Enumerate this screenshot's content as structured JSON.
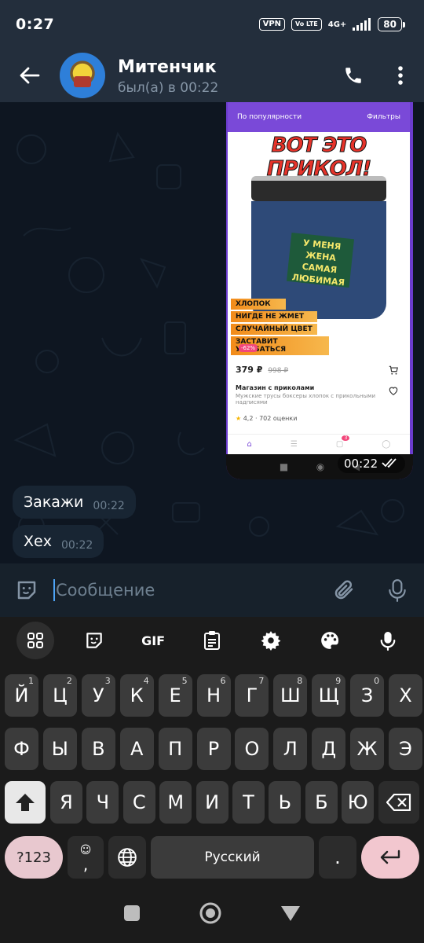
{
  "status_bar": {
    "time": "0:27",
    "vpn": "VPN",
    "volte": "Vo LTE",
    "network": "4G+",
    "battery": "80"
  },
  "header": {
    "name": "Митенчик",
    "status": "был(а) в 00:22"
  },
  "photo": {
    "filter_sort": "По популярности",
    "filter_label": "Фильтры",
    "headline": "ВОТ ЭТО ПРИКОЛ!",
    "print_text": [
      "У МЕНЯ ЖЕНА",
      "САМАЯ",
      "ЛЮБИМАЯ"
    ],
    "tags": [
      "ХЛОПОК",
      "НИГДЕ НЕ ЖМЕТ",
      "СЛУЧАЙНЫЙ ЦВЕТ",
      "ЗАСТАВИТ УЛЫБАТЬСЯ"
    ],
    "discount": "-62%",
    "price": "379 ₽",
    "old_price": "998 ₽",
    "shop": "Магазин с приколами",
    "description": "Мужские трусы боксеры хлопок с прикольными надписями",
    "rating": "4,2",
    "reviews": "702 оценки",
    "cart_count": "3",
    "time": "00:22"
  },
  "messages": [
    {
      "text": "Закажи",
      "time": "00:22"
    },
    {
      "text": "Хех",
      "time": "00:22"
    }
  ],
  "input": {
    "placeholder": "Сообщение"
  },
  "keyboard": {
    "toolbar": {
      "gif": "GIF"
    },
    "row1": [
      {
        "k": "Й",
        "h": "1"
      },
      {
        "k": "Ц",
        "h": "2"
      },
      {
        "k": "У",
        "h": "3"
      },
      {
        "k": "К",
        "h": "4"
      },
      {
        "k": "Е",
        "h": "5"
      },
      {
        "k": "Н",
        "h": "6"
      },
      {
        "k": "Г",
        "h": "7"
      },
      {
        "k": "Ш",
        "h": "8"
      },
      {
        "k": "Щ",
        "h": "9"
      },
      {
        "k": "З",
        "h": "0"
      },
      {
        "k": "Х",
        "h": ""
      }
    ],
    "row2": [
      "Ф",
      "Ы",
      "В",
      "А",
      "П",
      "Р",
      "О",
      "Л",
      "Д",
      "Ж",
      "Э"
    ],
    "row3": [
      "Я",
      "Ч",
      "С",
      "М",
      "И",
      "Т",
      "Ь",
      "Б",
      "Ю"
    ],
    "symbols": "?123",
    "comma": ",",
    "space": "Русский",
    "period": "."
  }
}
